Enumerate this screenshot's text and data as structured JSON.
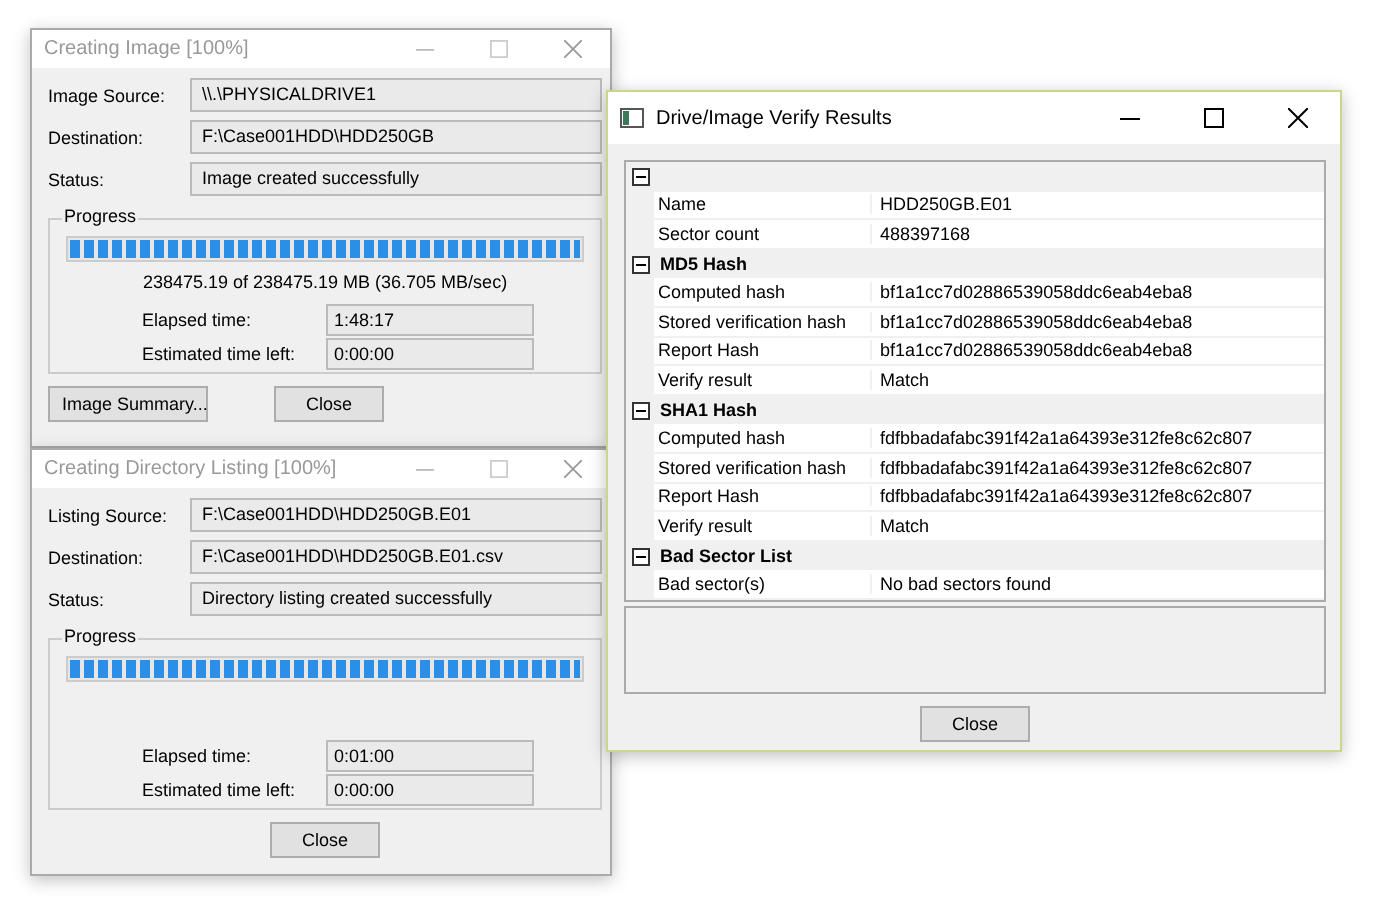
{
  "windows": [
    {
      "kind": "progress",
      "title": "Creating Image [100%]",
      "active": false,
      "fields": [
        {
          "label": "Image Source:",
          "value": "\\\\.\\PHYSICALDRIVE1"
        },
        {
          "label": "Destination:",
          "value": "F:\\Case001HDD\\HDD250GB"
        },
        {
          "label": "Status:",
          "value": "Image created successfully"
        }
      ],
      "progress": {
        "label": "Progress",
        "level": 1,
        "summary": "238475.19 of 238475.19 MB (36.705 MB/sec)",
        "times": [
          {
            "label": "Elapsed time:",
            "value": "1:48:17"
          },
          {
            "label": "Estimated time left:",
            "value": "0:00:00"
          }
        ]
      },
      "buttons": [
        "Image Summary...",
        "Close"
      ]
    },
    {
      "kind": "progress",
      "title": "Creating Directory Listing [100%]",
      "active": false,
      "fields": [
        {
          "label": "Listing Source:",
          "value": "F:\\Case001HDD\\HDD250GB.E01"
        },
        {
          "label": "Destination:",
          "value": "F:\\Case001HDD\\HDD250GB.E01.csv"
        },
        {
          "label": "Status:",
          "value": "Directory listing created successfully"
        }
      ],
      "progress": {
        "label": "Progress",
        "level": 1,
        "times": [
          {
            "label": "Elapsed time:",
            "value": "0:01:00"
          },
          {
            "label": "Estimated time left:",
            "value": "0:00:00"
          }
        ]
      },
      "buttons": [
        "Close"
      ]
    },
    {
      "kind": "verify",
      "title": "Drive/Image Verify Results",
      "active": true,
      "sections": [
        {
          "expanded": true,
          "rows": [
            {
              "name": "Name",
              "value": "HDD250GB.E01"
            },
            {
              "name": "Sector count",
              "value": "488397168"
            }
          ]
        },
        {
          "title": "MD5 Hash",
          "expanded": true,
          "rows": [
            {
              "name": "Computed hash",
              "value": "bf1a1cc7d02886539058ddc6eab4eba8"
            },
            {
              "name": "Stored verification hash",
              "value": "bf1a1cc7d02886539058ddc6eab4eba8"
            },
            {
              "name": "Report Hash",
              "value": "bf1a1cc7d02886539058ddc6eab4eba8"
            },
            {
              "name": "Verify result",
              "value": "Match"
            }
          ]
        },
        {
          "title": "SHA1 Hash",
          "expanded": true,
          "rows": [
            {
              "name": "Computed hash",
              "value": "fdfbbadafabc391f42a1a64393e312fe8c62c807"
            },
            {
              "name": "Stored verification hash",
              "value": "fdfbbadafabc391f42a1a64393e312fe8c62c807"
            },
            {
              "name": "Report Hash",
              "value": "fdfbbadafabc391f42a1a64393e312fe8c62c807"
            },
            {
              "name": "Verify result",
              "value": "Match"
            }
          ]
        },
        {
          "title": "Bad Sector List",
          "expanded": true,
          "rows": [
            {
              "name": "Bad sector(s)",
              "value": "No bad sectors found"
            }
          ]
        }
      ],
      "buttons": [
        "Close"
      ]
    }
  ]
}
